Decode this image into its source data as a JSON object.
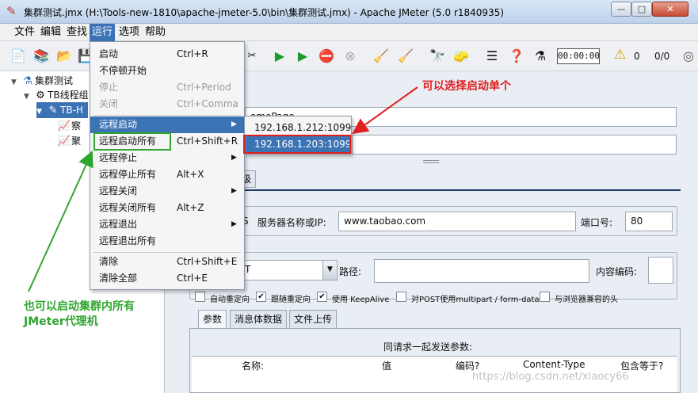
{
  "window": {
    "title": "集群测试.jmx (H:\\Tools-new-1810\\apache-jmeter-5.0\\bin\\集群测试.jmx) - Apache JMeter (5.0 r1840935)",
    "minimize": "—",
    "maximize": "□",
    "close": "✕"
  },
  "menubar": [
    "文件",
    "编辑",
    "查找",
    "运行",
    "选项",
    "帮助"
  ],
  "toolbar": {
    "timer": "00:00:00",
    "warn_count": "0",
    "thread_count": "0/0"
  },
  "tree": {
    "items": [
      {
        "label": "集群测试",
        "icon": "flask-icon"
      },
      {
        "label": "TB线程组",
        "icon": "gear-icon"
      },
      {
        "label": "TB-H",
        "icon": "pipette-icon"
      },
      {
        "label": "察",
        "icon": "chart-icon"
      },
      {
        "label": "聚",
        "icon": "chart-icon"
      }
    ]
  },
  "run_menu": {
    "items": [
      {
        "label": "启动",
        "accel": "Ctrl+R",
        "enabled": true
      },
      {
        "label": "不停顿开始",
        "accel": "",
        "enabled": true
      },
      {
        "label": "停止",
        "accel": "Ctrl+Period",
        "enabled": false
      },
      {
        "label": "关闭",
        "accel": "Ctrl+Comma",
        "enabled": false
      },
      {
        "label": "远程启动",
        "accel": "",
        "submenu": true
      },
      {
        "label": "远程启动所有",
        "accel": "Ctrl+Shift+R"
      },
      {
        "label": "远程停止",
        "accel": "",
        "submenu": true
      },
      {
        "label": "远程停止所有",
        "accel": "Alt+X"
      },
      {
        "label": "远程关闭",
        "accel": "",
        "submenu": true
      },
      {
        "label": "远程关闭所有",
        "accel": "Alt+Z"
      },
      {
        "label": "远程退出",
        "accel": "",
        "submenu": true
      },
      {
        "label": "远程退出所有",
        "accel": ""
      },
      {
        "label": "清除",
        "accel": "Ctrl+Shift+E"
      },
      {
        "label": "清除全部",
        "accel": "Ctrl+E"
      }
    ]
  },
  "remote_submenu": [
    "192.168.1.212:1099",
    "192.168.1.203:1099"
  ],
  "panel": {
    "name_value": "omePage",
    "tab_fragment": "级",
    "protocol_fragment": "S",
    "server_label": "服务器名称或IP:",
    "server_value": "www.taobao.com",
    "port_label": "端口号:",
    "port_value": "80",
    "method_fragment": "T",
    "path_label": "路径:",
    "encoding_label": "内容编码:",
    "checkboxes": [
      {
        "label": "自动重定向",
        "checked": false
      },
      {
        "label": "跟随重定向",
        "checked": true
      },
      {
        "label": "使用 KeepAlive",
        "checked": true
      },
      {
        "label": "对POST使用multipart / form-data",
        "checked": false
      },
      {
        "label": "与浏览器兼容的头",
        "checked": false
      }
    ],
    "subtabs": [
      "参数",
      "消息体数据",
      "文件上传"
    ],
    "send_with": "同请求一起发送参数:",
    "columns": [
      "名称:",
      "值",
      "编码?",
      "Content-Type",
      "包含等于?"
    ]
  },
  "annotations": {
    "red_note": "可以选择启动单个",
    "green_note_line1": "也可以启动集群内所有",
    "green_note_line2": "JMeter代理机"
  },
  "watermark": "https://blog.csdn.net/xiaocy66",
  "colors": {
    "selection": "#3c73b5",
    "red": "#e02020",
    "green": "#2fa52f"
  }
}
